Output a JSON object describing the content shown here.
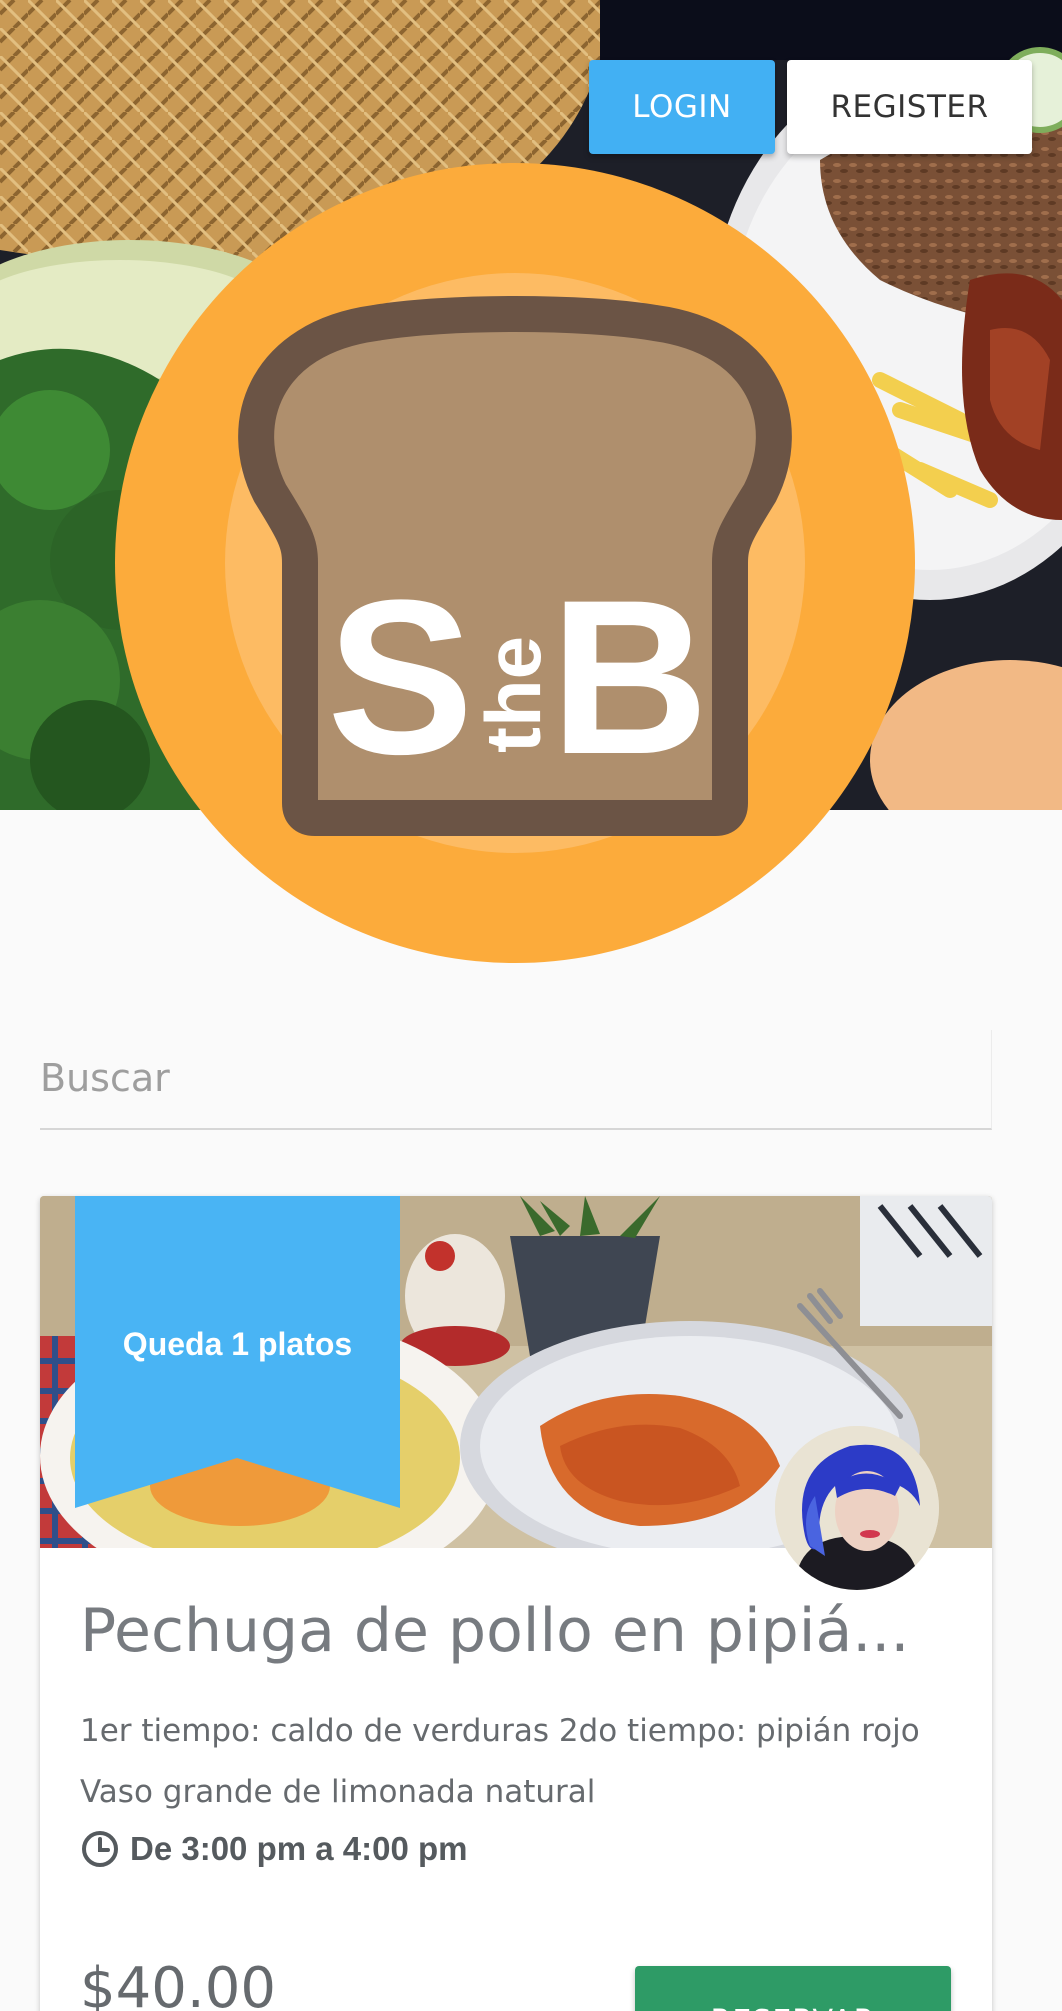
{
  "header": {
    "login_label": "LOGIN",
    "register_label": "REGISTER",
    "logo_icon": "bread-slice-logo-icon",
    "logo_letter_left": "S",
    "logo_letter_middle": "the",
    "logo_letter_right": "B"
  },
  "search": {
    "placeholder": "Buscar",
    "value": ""
  },
  "card": {
    "ribbon_text": "Queda 1 platos",
    "title": "Pechuga de pollo en pipiá...",
    "description": "1er tiempo: caldo de verduras 2do tiempo: pipián rojo Vaso grande de limonada natural",
    "time_icon": "clock-icon",
    "time": "De 3:00 pm a 4:00 pm",
    "price": "$40.00",
    "reserve_label": "RESERVAR"
  },
  "colors": {
    "primary_blue": "#42b0f3",
    "logo_orange": "#fcab3b",
    "bread_brown": "#6b5445",
    "bread_tan": "#af8f6d",
    "reserve_green": "#2e9b66"
  }
}
